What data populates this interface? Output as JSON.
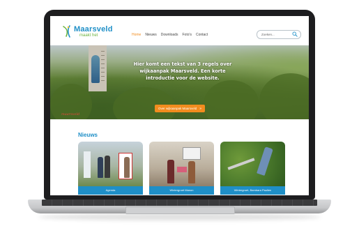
{
  "site": {
    "logo": {
      "title": "Maarsveld",
      "subtitle": "maakt het"
    },
    "nav": [
      {
        "label": "Home",
        "active": true
      },
      {
        "label": "Nieuws",
        "active": false
      },
      {
        "label": "Downloads",
        "active": false
      },
      {
        "label": "Foto's",
        "active": false
      },
      {
        "label": "Contact",
        "active": false
      }
    ],
    "search": {
      "placeholder": "Zoeken..."
    }
  },
  "hero": {
    "lines": [
      "Hier komt een tekst van 3 regels over",
      "wijkaanpak Maarsveld. Een korte",
      "introductie voor de website."
    ],
    "cta_label": "Over wijkaanpak Maarsveld",
    "cta_arrow": "»",
    "signature": "maarsveld"
  },
  "news": {
    "title": "Nieuws",
    "cards": [
      {
        "label": "Agenda"
      },
      {
        "label": "Wintergroet Manon"
      },
      {
        "label": "Wintergroet, Bambara Paulien"
      }
    ]
  },
  "colors": {
    "accent_blue": "#1f8fc7",
    "accent_orange": "#f28c1e",
    "brand_green": "#6cb33f"
  }
}
